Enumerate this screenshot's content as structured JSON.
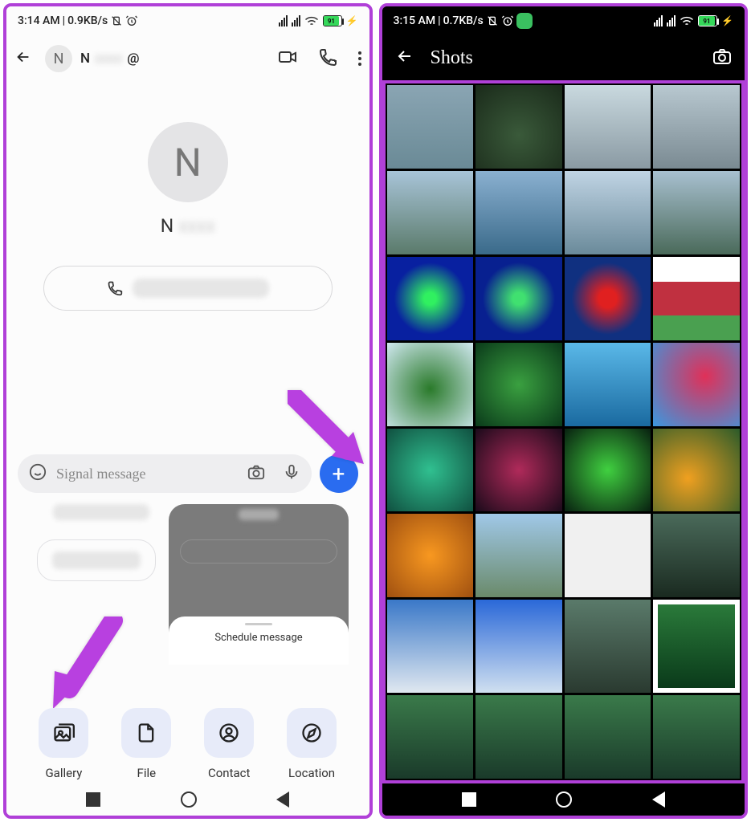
{
  "left": {
    "status": {
      "time": "3:14 AM",
      "speed": "0.9KB/s",
      "battery": "91"
    },
    "header": {
      "avatar": "N",
      "name": "N",
      "at": "@"
    },
    "center": {
      "avatar": "N",
      "name": "N"
    },
    "compose": {
      "placeholder": "Signal message"
    },
    "schedule": "Schedule message",
    "attachments": [
      {
        "label": "Gallery"
      },
      {
        "label": "File"
      },
      {
        "label": "Contact"
      },
      {
        "label": "Location"
      }
    ]
  },
  "right": {
    "status": {
      "time": "3:15 AM",
      "speed": "0.7KB/s",
      "battery": "91"
    },
    "title": "Shots"
  }
}
